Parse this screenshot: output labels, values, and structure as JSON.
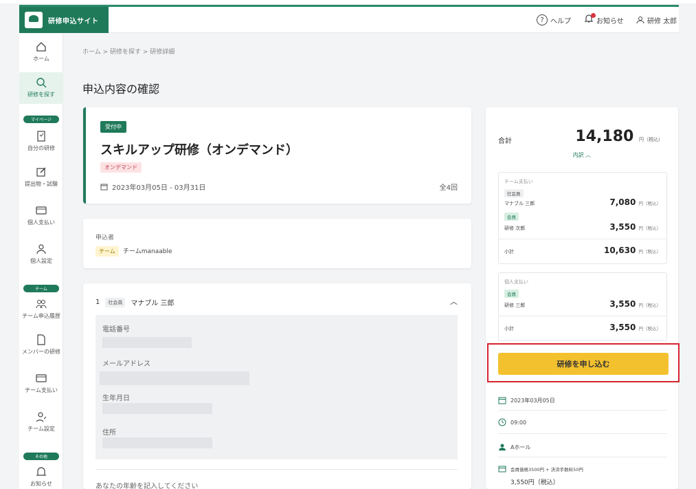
{
  "header": {
    "logo_text": "研修申込サイト",
    "help": "ヘルプ",
    "notifications": "お知らせ",
    "user": "研修 太郎"
  },
  "sidebar": {
    "home": "ホーム",
    "search": "研修を探す",
    "section_mypage": "マイページ",
    "my_courses": "自分の研修",
    "submissions": "提出物・試験",
    "personal_payment": "個人支払い",
    "personal_settings": "個人設定",
    "section_team": "チーム",
    "team_history": "チーム申込履歴",
    "member_courses": "メンバーの研修",
    "team_payment": "チーム支払い",
    "team_settings": "チーム設定",
    "section_other": "その他",
    "notice": "お知らせ"
  },
  "breadcrumb": "ホーム > 研修を探す > 研修詳細",
  "page_title": "申込内容の確認",
  "course": {
    "status": "受付中",
    "title": "スキルアップ研修（オンデマンド）",
    "type": "オンデマンド",
    "date_range": "2023年03月05日 - 03月31日",
    "sessions": "全4回"
  },
  "applicant": {
    "label": "申込者",
    "team_chip": "チーム",
    "team_name": "チームmanaable"
  },
  "member": {
    "number": "1",
    "chip": "社会員",
    "name": "マナブル 三郎",
    "phone_label": "電話番号",
    "email_label": "メールアドレス",
    "birthday_label": "生年月日",
    "address_label": "住所",
    "age_prompt": "あなたの年齢を記入してください"
  },
  "summary": {
    "total_label": "合計",
    "total_value": "14,180",
    "yen_tax": "円（税込）",
    "breakdown": "内訳 ︿",
    "team_box": {
      "title": "チーム支払い",
      "chip1": "社会員",
      "name1": "マナブル 三郎",
      "amount1": "7,080",
      "chip2": "会員",
      "name2": "研修 次郎",
      "amount2": "3,550",
      "subtotal_label": "小計",
      "subtotal": "10,630"
    },
    "personal_box": {
      "title": "個人支払い",
      "chip1": "会員",
      "name1": "研修 三郎",
      "amount1": "3,550",
      "subtotal_label": "小計",
      "subtotal": "3,550"
    },
    "apply_button": "研修を申し込む",
    "meta_date": "2023年03月05日",
    "meta_time": "09:00",
    "meta_place": "Aホール",
    "meta_fee_line1": "会員価格3500円 + 決済手数料50円",
    "meta_fee_line2": "3,550円（税込）"
  }
}
